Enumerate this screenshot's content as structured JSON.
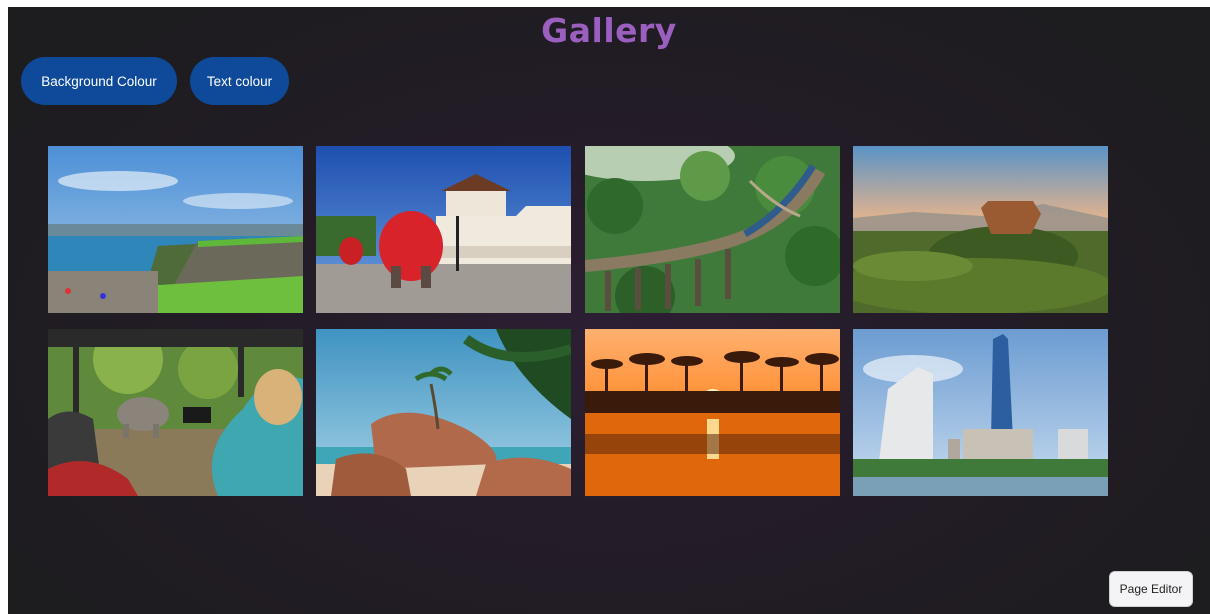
{
  "page": {
    "title": "Gallery",
    "title_color": "#9b5fc0",
    "background": "#241c28"
  },
  "controls": {
    "background_colour_label": "Background Colour",
    "text_colour_label": "Text colour",
    "button_color": "#0f4a9a"
  },
  "gallery": {
    "images": [
      {
        "subject": "coastal fort with ramparts and harbour"
      },
      {
        "subject": "temple with decorated elephant"
      },
      {
        "subject": "train crossing arched bridge in jungle"
      },
      {
        "subject": "rock fortress rising above forest"
      },
      {
        "subject": "tourist photographing elephant from safari jeep"
      },
      {
        "subject": "tropical beach with boulders and palm trees"
      },
      {
        "subject": "sunset over lake with palm silhouettes"
      },
      {
        "subject": "city skyline with tall towers by water"
      }
    ]
  },
  "footer": {
    "page_editor_label": "Page Editor"
  }
}
